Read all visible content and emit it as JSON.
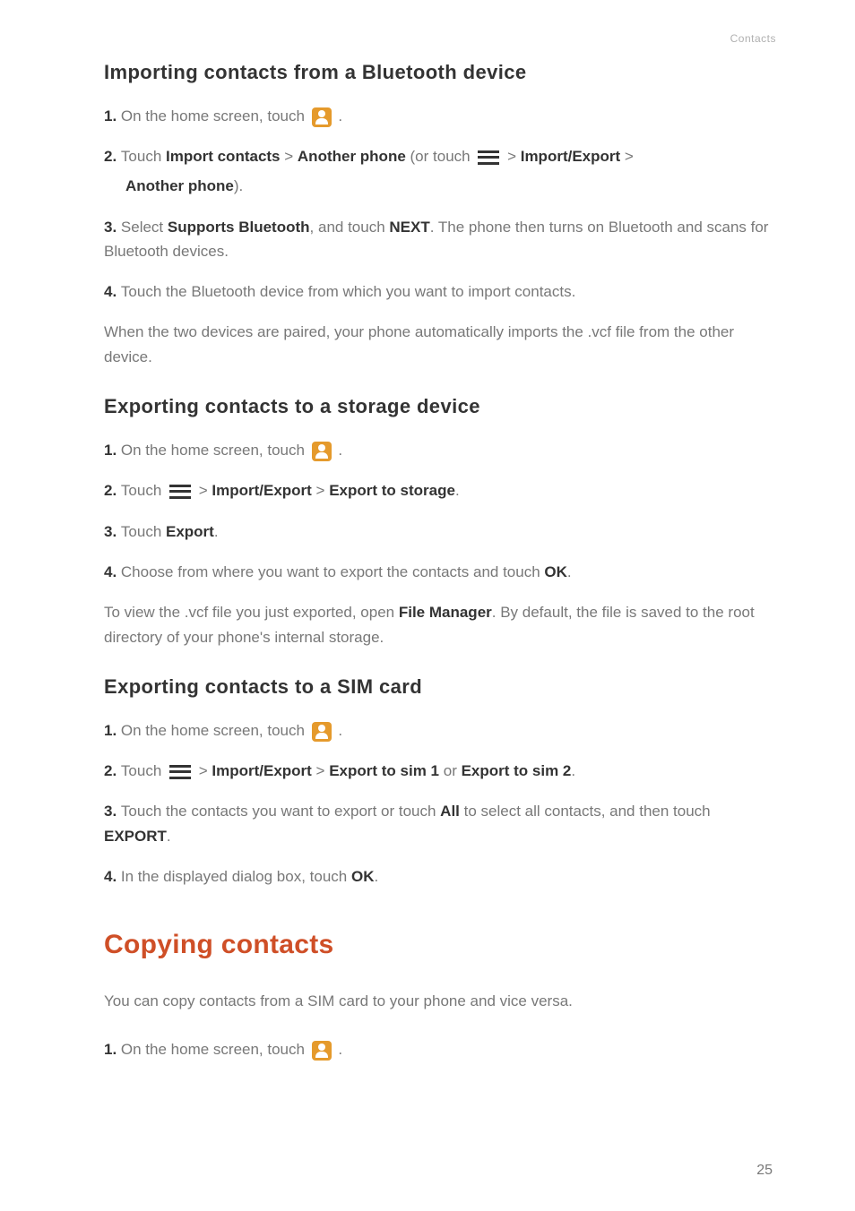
{
  "header": {
    "category": "Contacts"
  },
  "section1": {
    "title": "Importing contacts from a Bluetooth device",
    "step1_prefix": "1. ",
    "step1_text": "On the home screen, touch ",
    "step1_suffix": " .",
    "step2_prefix": "2. ",
    "step2_t1": "Touch ",
    "step2_b1": "Import contacts",
    "step2_t2": " > ",
    "step2_b2": "Another phone",
    "step2_t3": " (or touch ",
    "step2_t4": " > ",
    "step2_b3": "Import/Export",
    "step2_t5": " > ",
    "step2_b4": "Another phone",
    "step2_t6": ").",
    "step3_prefix": "3. ",
    "step3_t1": "Select ",
    "step3_b1": "Supports Bluetooth",
    "step3_t2": ", and touch ",
    "step3_b2": "NEXT",
    "step3_t3": ". The phone then turns on Bluetooth and scans for Bluetooth devices.",
    "step4_prefix": "4. ",
    "step4_text": "Touch the Bluetooth device from which you want to import contacts.",
    "body": "When the two devices are paired, your phone automatically imports the .vcf file from the other device."
  },
  "section2": {
    "title": "Exporting contacts to a storage device",
    "step1_prefix": "1. ",
    "step1_text": "On the home screen, touch ",
    "step1_suffix": " .",
    "step2_prefix": "2. ",
    "step2_t1": "Touch ",
    "step2_t2": " > ",
    "step2_b1": "Import/Export",
    "step2_t3": " > ",
    "step2_b2": "Export to storage",
    "step2_t4": ".",
    "step3_prefix": "3. ",
    "step3_t1": "Touch ",
    "step3_b1": "Export",
    "step3_t2": ".",
    "step4_prefix": "4. ",
    "step4_t1": "Choose from where you want to export the contacts and touch ",
    "step4_b1": "OK",
    "step4_t2": ".",
    "body_t1": "To view the .vcf file you just exported, open ",
    "body_b1": "File Manager",
    "body_t2": ". By default, the file is saved to the root directory of your phone's internal storage."
  },
  "section3": {
    "title": "Exporting contacts to a SIM card",
    "step1_prefix": "1. ",
    "step1_text": "On the home screen, touch ",
    "step1_suffix": " .",
    "step2_prefix": "2. ",
    "step2_t1": "Touch ",
    "step2_t2": " > ",
    "step2_b1": "Import/Export",
    "step2_t3": " > ",
    "step2_b2": "Export to sim 1",
    "step2_t4": " or ",
    "step2_b3": "Export to sim 2",
    "step2_t5": ".",
    "step3_prefix": "3. ",
    "step3_t1": "Touch the contacts you want to export or touch ",
    "step3_b1": "All",
    "step3_t2": " to select all contacts, and then touch ",
    "step3_b2": "EXPORT",
    "step3_t3": ".",
    "step4_prefix": "4. ",
    "step4_t1": "In the displayed dialog box, touch ",
    "step4_b1": "OK",
    "step4_t2": "."
  },
  "section4": {
    "title": "Copying contacts",
    "body": "You can copy contacts from a SIM card to your phone and vice versa.",
    "step1_prefix": "1. ",
    "step1_text": "On the home screen, touch ",
    "step1_suffix": " ."
  },
  "page": {
    "number": "25"
  }
}
